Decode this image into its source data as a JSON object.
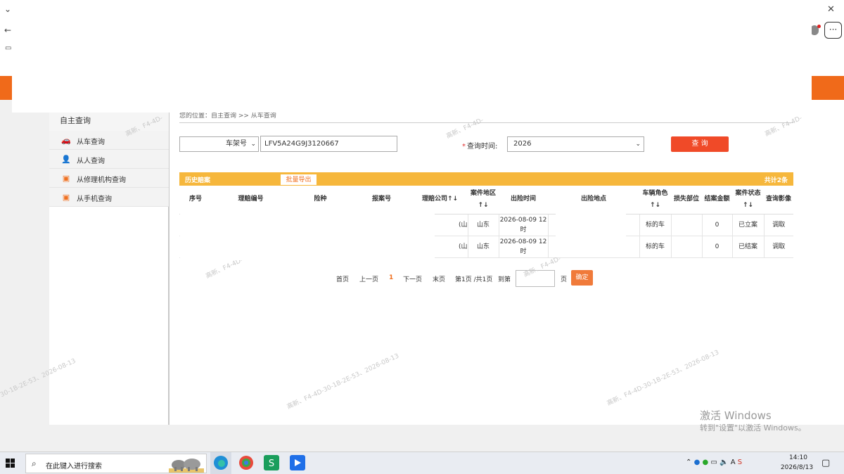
{
  "browser": {
    "more_icon": "ellipsis-icon",
    "back_icon": "back-arrow-icon"
  },
  "sidebar": {
    "title": "自主查询",
    "items": [
      {
        "label": "从车查询",
        "icon": "car-icon",
        "active": true
      },
      {
        "label": "从人查询",
        "icon": "person-icon"
      },
      {
        "label": "从修理机构查询",
        "icon": "building-icon"
      },
      {
        "label": "从手机查询",
        "icon": "phone-icon"
      }
    ]
  },
  "breadcrumb": "您的位置：自主查询 >> 从车查询",
  "search": {
    "type_selected": "车架号",
    "vin_value": "LFV5A24G9J3120667",
    "time_label": "查询时间:",
    "year_selected": "2026",
    "query_label": "查 询"
  },
  "panel": {
    "title": "历史赔案",
    "export_label": "批量导出",
    "total": "共计2条"
  },
  "table": {
    "headers": [
      "序号",
      "理赔编号",
      "险种",
      "报案号",
      "理赔公司↑↓",
      "案件地区↑↓",
      "出险时间",
      "出险地点",
      "车辆角色↑↓",
      "损失部位",
      "结案金额",
      "案件状态↑↓",
      "查询影像"
    ],
    "rows": [
      {
        "company": "(山",
        "region": "山东",
        "time": "2026-08-09 12时",
        "role": "标的车",
        "loss": "",
        "amount": "0",
        "status": "已立案",
        "action": "调取"
      },
      {
        "company": "(山",
        "region": "山东",
        "time": "2026-08-09 12时",
        "role": "标的车",
        "loss": "",
        "amount": "0",
        "status": "已结案",
        "action": "调取"
      }
    ]
  },
  "pagination": {
    "first": "首页",
    "prev": "上一页",
    "current": "1",
    "next": "下一页",
    "last": "末页",
    "info": "第1页 /共1页",
    "goto": "到第",
    "page_unit": "页",
    "ok": "确定"
  },
  "watermark": {
    "text1": "高新、F4-4D-30-1B-2E-53、2026-08-13",
    "text2": "高新、F4-4D-",
    "text3": "30-1B-2E-53、2026-08-13"
  },
  "activation": {
    "line1": "激活 Windows",
    "line2": "转到\"设置\"以激活 Windows。"
  },
  "taskbar": {
    "search_placeholder": "在此键入进行搜索",
    "time": "14:10",
    "date": "2026/8/13",
    "ime": "A"
  },
  "colors": {
    "brand_orange": "#f06a1a",
    "panel_yellow": "#f6b73c",
    "query_red": "#f04a28"
  }
}
